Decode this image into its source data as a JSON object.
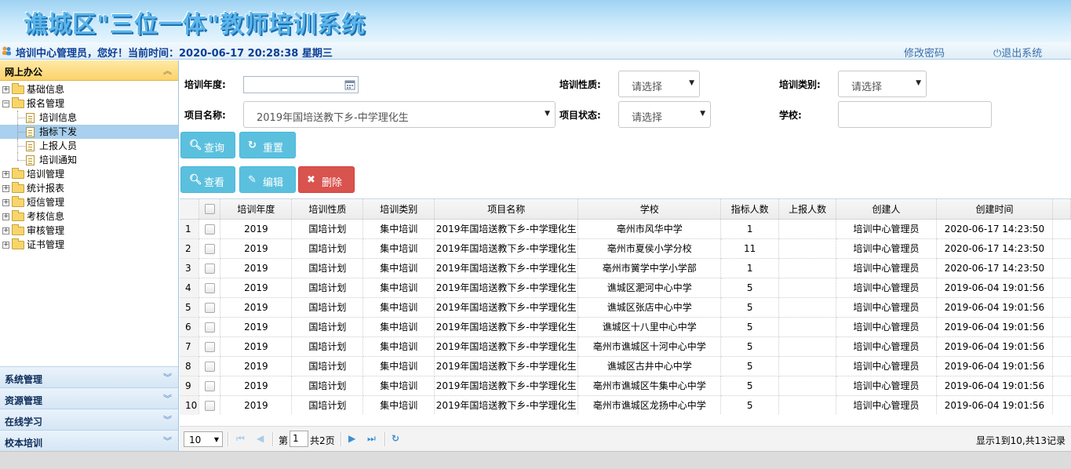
{
  "app": {
    "title": "谯城区\"三位一体\"教师培训系统"
  },
  "topbar": {
    "welcome": "培训中心管理员，您好！当前时间：2020-06-17 20:28:38 星期三",
    "change_password": "修改密码",
    "logout": "退出系统"
  },
  "sidebar": {
    "header": "网上办公",
    "tree": [
      {
        "label": "基础信息",
        "type": "folder",
        "expanded": false
      },
      {
        "label": "报名管理",
        "type": "folder",
        "expanded": true
      },
      {
        "label": "培训信息",
        "type": "leaf"
      },
      {
        "label": "指标下发",
        "type": "leaf",
        "selected": true
      },
      {
        "label": "上报人员",
        "type": "leaf"
      },
      {
        "label": "培训通知",
        "type": "leaf"
      },
      {
        "label": "培训管理",
        "type": "folder",
        "expanded": false
      },
      {
        "label": "统计报表",
        "type": "folder",
        "expanded": false
      },
      {
        "label": "短信管理",
        "type": "folder",
        "expanded": false
      },
      {
        "label": "考核信息",
        "type": "folder",
        "expanded": false
      },
      {
        "label": "审核管理",
        "type": "folder",
        "expanded": false
      },
      {
        "label": "证书管理",
        "type": "folder",
        "expanded": false
      }
    ],
    "accordion": [
      "系统管理",
      "资源管理",
      "在线学习",
      "校本培训"
    ]
  },
  "filters": {
    "year_label": "培训年度:",
    "year_value": "",
    "nature_label": "培训性质:",
    "nature_value": "请选择",
    "category_label": "培训类别:",
    "category_value": "请选择",
    "project_label": "项目名称:",
    "project_value": "2019年国培送教下乡-中学理化生",
    "status_label": "项目状态:",
    "status_value": "请选择",
    "school_label": "学校:",
    "school_value": ""
  },
  "buttons": {
    "search": "查询",
    "reset": "重置",
    "view": "查看",
    "edit": "编辑",
    "delete": "删除"
  },
  "table": {
    "columns": [
      "培训年度",
      "培训性质",
      "培训类别",
      "项目名称",
      "学校",
      "指标人数",
      "上报人数",
      "创建人",
      "创建时间"
    ],
    "rows": [
      [
        "1",
        "2019",
        "国培计划",
        "集中培训",
        "2019年国培送教下乡-中学理化生",
        "亳州市风华中学",
        "1",
        "",
        "培训中心管理员",
        "2020-06-17 14:23:50"
      ],
      [
        "2",
        "2019",
        "国培计划",
        "集中培训",
        "2019年国培送教下乡-中学理化生",
        "亳州市夏侯小学分校",
        "11",
        "",
        "培训中心管理员",
        "2020-06-17 14:23:50"
      ],
      [
        "3",
        "2019",
        "国培计划",
        "集中培训",
        "2019年国培送教下乡-中学理化生",
        "亳州市黉学中学小学部",
        "1",
        "",
        "培训中心管理员",
        "2020-06-17 14:23:50"
      ],
      [
        "4",
        "2019",
        "国培计划",
        "集中培训",
        "2019年国培送教下乡-中学理化生",
        "谯城区淝河中心中学",
        "5",
        "",
        "培训中心管理员",
        "2019-06-04 19:01:56"
      ],
      [
        "5",
        "2019",
        "国培计划",
        "集中培训",
        "2019年国培送教下乡-中学理化生",
        "谯城区张店中心中学",
        "5",
        "",
        "培训中心管理员",
        "2019-06-04 19:01:56"
      ],
      [
        "6",
        "2019",
        "国培计划",
        "集中培训",
        "2019年国培送教下乡-中学理化生",
        "谯城区十八里中心中学",
        "5",
        "",
        "培训中心管理员",
        "2019-06-04 19:01:56"
      ],
      [
        "7",
        "2019",
        "国培计划",
        "集中培训",
        "2019年国培送教下乡-中学理化生",
        "亳州市谯城区十河中心中学",
        "5",
        "",
        "培训中心管理员",
        "2019-06-04 19:01:56"
      ],
      [
        "8",
        "2019",
        "国培计划",
        "集中培训",
        "2019年国培送教下乡-中学理化生",
        "谯城区古井中心中学",
        "5",
        "",
        "培训中心管理员",
        "2019-06-04 19:01:56"
      ],
      [
        "9",
        "2019",
        "国培计划",
        "集中培训",
        "2019年国培送教下乡-中学理化生",
        "亳州市谯城区牛集中心中学",
        "5",
        "",
        "培训中心管理员",
        "2019-06-04 19:01:56"
      ],
      [
        "10",
        "2019",
        "国培计划",
        "集中培训",
        "2019年国培送教下乡-中学理化生",
        "亳州市谯城区龙扬中心中学",
        "5",
        "",
        "培训中心管理员",
        "2019-06-04 19:01:56"
      ]
    ]
  },
  "pager": {
    "page_size": "10",
    "page_prefix": "第",
    "page_number": "1",
    "page_total": "共2页",
    "info": "显示1到10,共13记录"
  }
}
